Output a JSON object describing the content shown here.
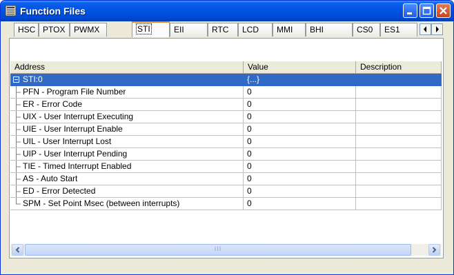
{
  "window": {
    "title": "Function Files"
  },
  "tabs": [
    "HSC",
    "PTOX",
    "PWMX",
    "STI",
    "EII",
    "RTC",
    "LCD",
    "MMI",
    "BHI",
    "CS0",
    "ES1"
  ],
  "active_tab": "STI",
  "columns": {
    "address": "Address",
    "value": "Value",
    "description": "Description"
  },
  "rows": [
    {
      "address": "STI:0",
      "value": "{...}",
      "description": ""
    },
    {
      "address": "PFN - Program File Number",
      "value": "0",
      "description": ""
    },
    {
      "address": "ER - Error Code",
      "value": "0",
      "description": ""
    },
    {
      "address": "UIX - User Interrupt Executing",
      "value": "0",
      "description": ""
    },
    {
      "address": "UIE - User Interrupt Enable",
      "value": "0",
      "description": ""
    },
    {
      "address": "UIL - User Interrupt Lost",
      "value": "0",
      "description": ""
    },
    {
      "address": "UIP - User Interrupt Pending",
      "value": "0",
      "description": ""
    },
    {
      "address": "TIE - Timed Interrupt Enabled",
      "value": "0",
      "description": ""
    },
    {
      "address": "AS - Auto Start",
      "value": "0",
      "description": ""
    },
    {
      "address": "ED - Error Detected",
      "value": "0",
      "description": ""
    },
    {
      "address": "SPM - Set Point Msec (between interrupts)",
      "value": "0",
      "description": ""
    }
  ],
  "scrollbar": {
    "thumb_grip": "III"
  },
  "colors": {
    "titlebar": "#0054e3",
    "selection": "#316ac5",
    "active_tab_accent": "#e68b2c"
  }
}
